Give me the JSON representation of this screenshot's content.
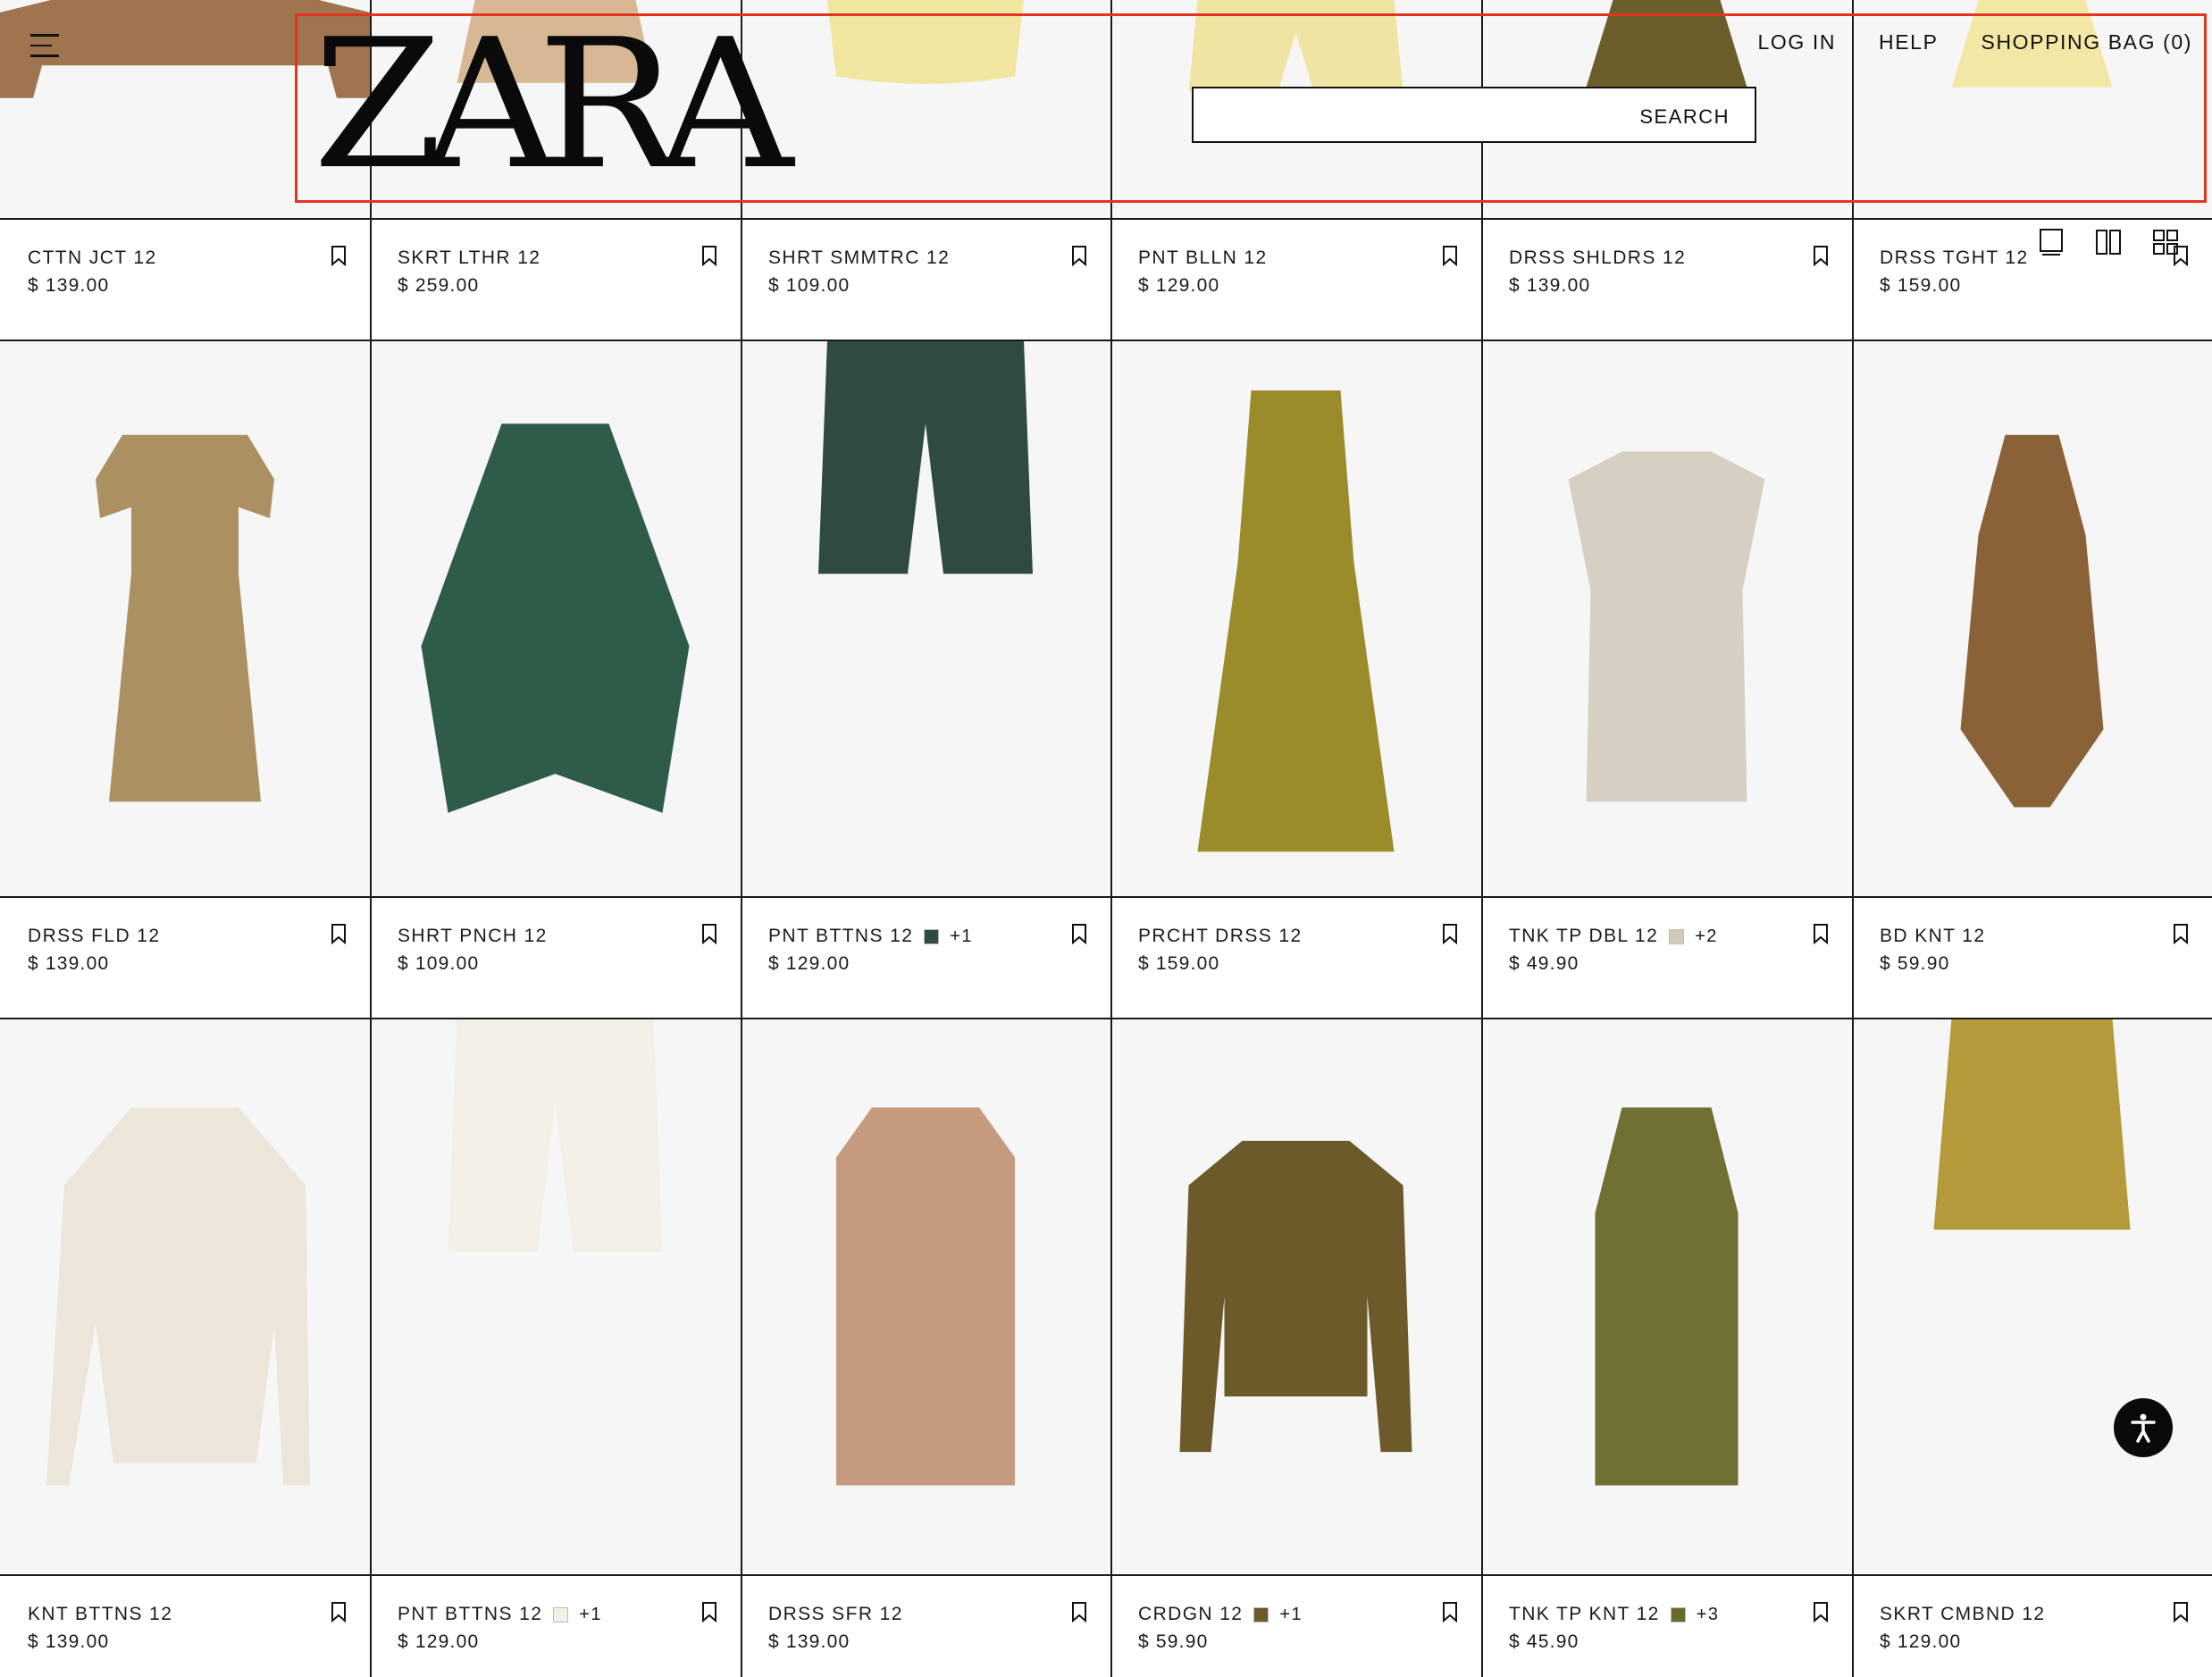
{
  "header": {
    "logo": "ZARA",
    "search_label": "SEARCH",
    "search_placeholder": "",
    "links": [
      "LOG IN",
      "HELP",
      "SHOPPING BAG (0)"
    ]
  },
  "rows": [
    [
      {
        "name": "CTTN JCT 12",
        "price": "$ 139.00"
      },
      {
        "name": "SKRT LTHR 12",
        "price": "$ 259.00"
      },
      {
        "name": "SHRT SMMTRC 12",
        "price": "$ 109.00"
      },
      {
        "name": "PNT BLLN 12",
        "price": "$ 129.00"
      },
      {
        "name": "DRSS SHLDRS 12",
        "price": "$ 139.00"
      },
      {
        "name": "DRSS TGHT 12",
        "price": "$ 159.00"
      }
    ],
    [
      {
        "name": "DRSS FLD 12",
        "price": "$ 139.00"
      },
      {
        "name": "SHRT PNCH 12",
        "price": "$ 109.00"
      },
      {
        "name": "PNT BTTNS 12",
        "price": "$ 129.00",
        "swatch": "#2f4a40",
        "more": "+1"
      },
      {
        "name": "PRCHT DRSS 12",
        "price": "$ 159.00"
      },
      {
        "name": "TNK TP DBL 12",
        "price": "$ 49.90",
        "swatch": "#cfcbb8",
        "more": "+2"
      },
      {
        "name": "BD KNT 12",
        "price": "$ 59.90"
      }
    ],
    [
      {
        "name": "KNT BTTNS 12",
        "price": "$ 139.00"
      },
      {
        "name": "PNT BTTNS 12",
        "price": "$ 129.00",
        "swatch": "#f6efe6",
        "more": "+1"
      },
      {
        "name": "DRSS SFR 12",
        "price": "$ 139.00"
      },
      {
        "name": "CRDGN 12",
        "price": "$ 59.90",
        "swatch": "#6b5a2c",
        "more": "+1"
      },
      {
        "name": "TNK TP KNT 12",
        "price": "$ 45.90",
        "swatch": "#6b6a2e",
        "more": "+3"
      },
      {
        "name": "SKRT CMBND 12",
        "price": "$ 129.00"
      }
    ]
  ],
  "colors": {
    "highlight_box": "#e3341f",
    "grid_line": "#1a1a1a",
    "image_bg": "#f6f6f6"
  },
  "icons": [
    "menu-icon",
    "bookmark-icon",
    "view-single-icon",
    "view-double-icon",
    "view-grid-icon",
    "accessibility-icon"
  ]
}
